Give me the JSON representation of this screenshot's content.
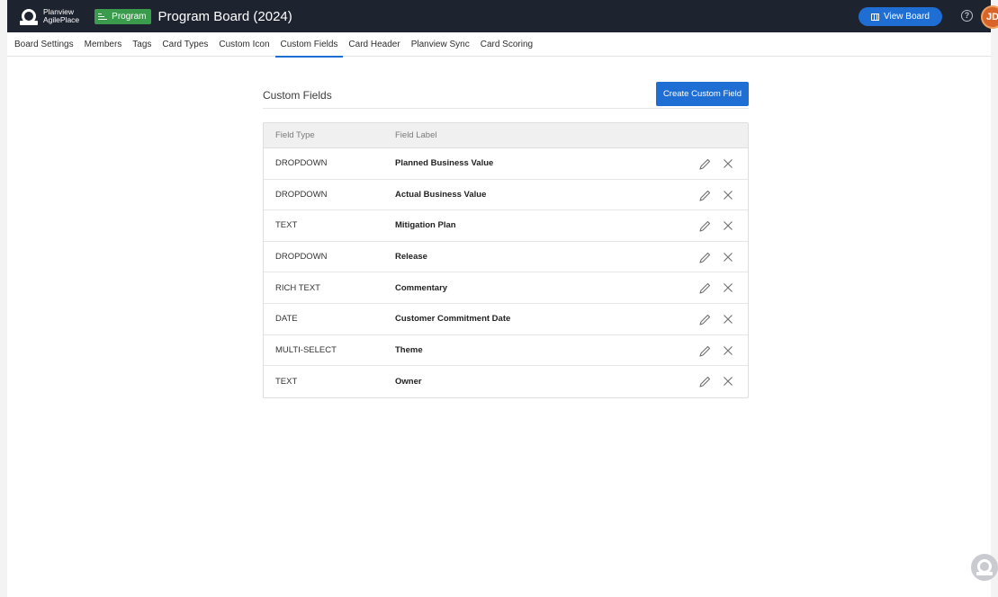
{
  "app": {
    "logo_line1": "Planview",
    "logo_line2": "AgilePlace",
    "badge": "Program",
    "board_title": "Program Board (2024)",
    "view_board_label": "View Board",
    "help_glyph": "?",
    "avatar_initials": "JD",
    "accent_color": "#1f6ed4",
    "badge_color": "#3a9b4c",
    "avatar_color": "#d8642a"
  },
  "tabs": [
    {
      "label": "Board Settings",
      "active": false
    },
    {
      "label": "Members",
      "active": false
    },
    {
      "label": "Tags",
      "active": false
    },
    {
      "label": "Card Types",
      "active": false
    },
    {
      "label": "Custom Icon",
      "active": false
    },
    {
      "label": "Custom Fields",
      "active": true
    },
    {
      "label": "Card Header",
      "active": false
    },
    {
      "label": "Planview Sync",
      "active": false
    },
    {
      "label": "Card Scoring",
      "active": false
    }
  ],
  "section": {
    "title": "Custom Fields",
    "create_label": "Create Custom Field"
  },
  "table": {
    "headers": {
      "type": "Field Type",
      "label": "Field Label"
    },
    "rows": [
      {
        "type": "DROPDOWN",
        "label": "Planned Business Value"
      },
      {
        "type": "DROPDOWN",
        "label": "Actual Business Value"
      },
      {
        "type": "TEXT",
        "label": "Mitigation Plan"
      },
      {
        "type": "DROPDOWN",
        "label": "Release"
      },
      {
        "type": "RICH TEXT",
        "label": "Commentary"
      },
      {
        "type": "DATE",
        "label": "Customer Commitment Date"
      },
      {
        "type": "MULTI-SELECT",
        "label": "Theme"
      },
      {
        "type": "TEXT",
        "label": "Owner"
      }
    ],
    "row_icons": [
      "pencil-icon",
      "close-icon"
    ]
  }
}
